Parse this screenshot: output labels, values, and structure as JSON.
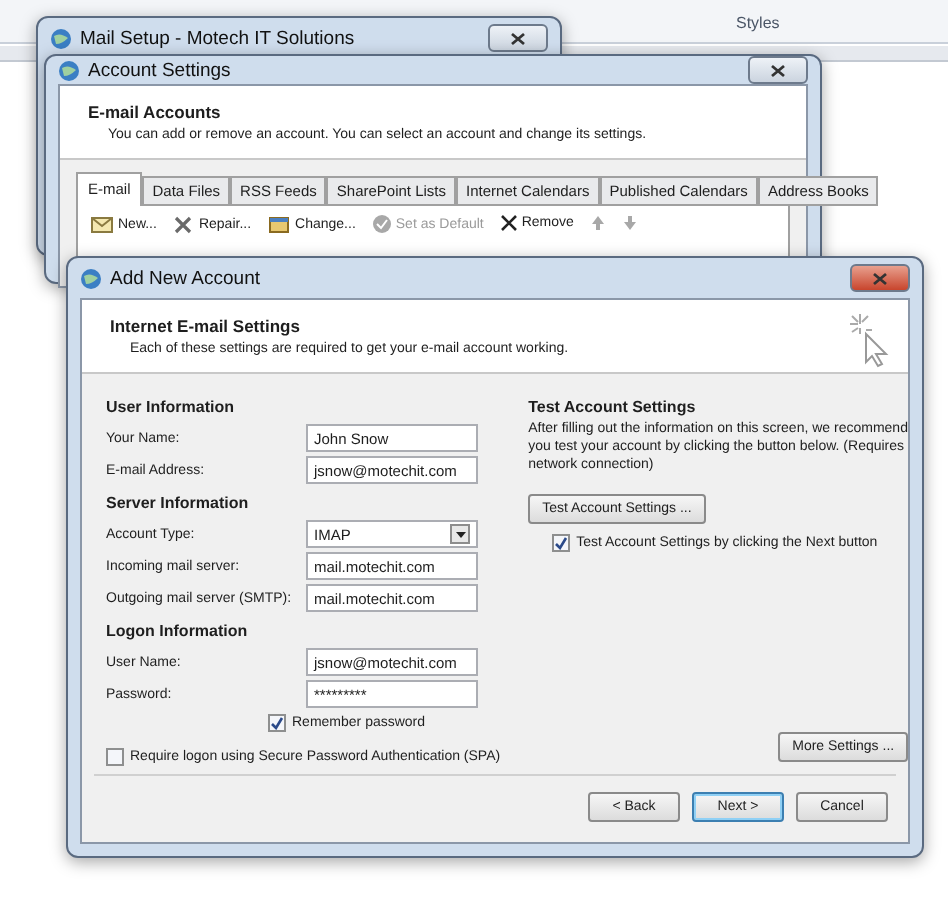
{
  "background": {
    "ribbon_group": "Styles"
  },
  "mail_setup": {
    "title": "Mail Setup - Motech IT Solutions"
  },
  "account_settings": {
    "title": "Account Settings",
    "heading": "E-mail Accounts",
    "description": "You can add or remove an account. You can select an account and change its settings.",
    "tabs": [
      {
        "label": "E-mail",
        "selected": true
      },
      {
        "label": "Data Files",
        "selected": false
      },
      {
        "label": "RSS Feeds",
        "selected": false
      },
      {
        "label": "SharePoint Lists",
        "selected": false
      },
      {
        "label": "Internet Calendars",
        "selected": false
      },
      {
        "label": "Published Calendars",
        "selected": false
      },
      {
        "label": "Address Books",
        "selected": false
      }
    ],
    "toolbar": [
      {
        "kind": "new",
        "label": "New...",
        "disabled": false
      },
      {
        "kind": "repair",
        "label": "Repair...",
        "disabled": false
      },
      {
        "kind": "change",
        "label": "Change...",
        "disabled": false
      },
      {
        "kind": "default",
        "label": "Set as Default",
        "disabled": true
      },
      {
        "kind": "remove",
        "label": "Remove",
        "disabled": false
      },
      {
        "kind": "up",
        "disabled": true
      },
      {
        "kind": "down",
        "disabled": true
      }
    ]
  },
  "add_account": {
    "title": "Add New Account",
    "heading": "Internet E-mail Settings",
    "description": "Each of these settings are required to get your e-mail account working.",
    "sections": [
      {
        "title": "User Information",
        "fields": [
          {
            "kind": "text",
            "label": "Your Name:",
            "value": "John Snow"
          },
          {
            "kind": "text",
            "label": "E-mail Address:",
            "value": "jsnow@motechit.com"
          }
        ]
      },
      {
        "title": "Server Information",
        "fields": [
          {
            "kind": "select",
            "label": "Account Type:",
            "value": "IMAP"
          },
          {
            "kind": "text",
            "label": "Incoming mail server:",
            "value": "mail.motechit.com"
          },
          {
            "kind": "text",
            "label": "Outgoing mail server (SMTP):",
            "value": "mail.motechit.com"
          }
        ]
      },
      {
        "title": "Logon Information",
        "fields": [
          {
            "kind": "text",
            "label": "User Name:",
            "value": "jsnow@motechit.com"
          },
          {
            "kind": "password",
            "label": "Password:",
            "value": "*********"
          }
        ]
      }
    ],
    "remember_password": {
      "label": "Remember password",
      "checked": true
    },
    "spa": {
      "label": "Require logon using Secure Password Authentication (SPA)",
      "checked": false
    },
    "test": {
      "title": "Test Account Settings",
      "description": "After filling out the information on this screen, we recommend you test your account by clicking the button below. (Requires network connection)",
      "button": "Test Account Settings ...",
      "on_next": {
        "label": "Test Account Settings by clicking the Next button",
        "checked": true
      }
    },
    "more_settings": "More Settings ...",
    "buttons": [
      {
        "label": "< Back",
        "default": false
      },
      {
        "label": "Next >",
        "default": true
      },
      {
        "label": "Cancel",
        "default": false
      }
    ]
  }
}
